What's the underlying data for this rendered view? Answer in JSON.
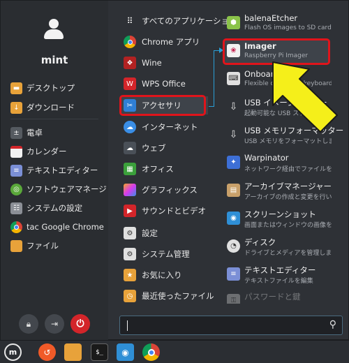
{
  "user": {
    "name": "mint"
  },
  "favorites": [
    {
      "label": "デスクトップ",
      "icon": "desktop-folder-icon",
      "color": "#e8a23a"
    },
    {
      "label": "ダウンロード",
      "icon": "downloads-folder-icon",
      "color": "#e8a23a"
    },
    {
      "label": "電卓",
      "icon": "calculator-icon",
      "color": "#555a60"
    },
    {
      "label": "カレンダー",
      "icon": "calendar-icon",
      "color": "#f2f2f2"
    },
    {
      "label": "テキストエディター",
      "icon": "text-editor-icon",
      "color": "#7b8fd6"
    },
    {
      "label": "ソフトウェアマネージャー",
      "icon": "software-manager-icon",
      "color": "#5aa83a"
    },
    {
      "label": "システムの設定",
      "icon": "system-settings-icon",
      "color": "#8b8f96"
    },
    {
      "label": "tac Google Chrome",
      "icon": "chrome-icon",
      "color": "#4285f4"
    },
    {
      "label": "ファイル",
      "icon": "files-folder-icon",
      "color": "#e8a23a"
    }
  ],
  "categories": [
    {
      "label": "すべてのアプリケーション",
      "icon": "all-apps-icon",
      "color": "#2e3136"
    },
    {
      "label": "Chrome アプリ",
      "icon": "chrome-icon",
      "color": "#4285f4"
    },
    {
      "label": "Wine",
      "icon": "wine-icon",
      "color": "#b22222"
    },
    {
      "label": "WPS Office",
      "icon": "wps-office-icon",
      "color": "#d3252a"
    },
    {
      "label": "アクセサリ",
      "icon": "accessories-icon",
      "color": "#2f7fd6"
    },
    {
      "label": "インターネット",
      "icon": "internet-icon",
      "color": "#3a8ee6"
    },
    {
      "label": "ウェブ",
      "icon": "web-icon",
      "color": "#4a5058"
    },
    {
      "label": "オフィス",
      "icon": "office-icon",
      "color": "#3ba03b"
    },
    {
      "label": "グラフィックス",
      "icon": "graphics-icon",
      "color": "#c04ad6"
    },
    {
      "label": "サウンドとビデオ",
      "icon": "sound-video-icon",
      "color": "#d3252a"
    },
    {
      "label": "設定",
      "icon": "settings-icon",
      "color": "#e0e0e0"
    },
    {
      "label": "システム管理",
      "icon": "system-admin-icon",
      "color": "#e0e0e0"
    },
    {
      "label": "お気に入り",
      "icon": "favorites-icon",
      "color": "#e8a23a"
    },
    {
      "label": "最近使ったファイル",
      "icon": "recent-files-icon",
      "color": "#e8a23a"
    }
  ],
  "apps": [
    {
      "name": "balenaEtcher",
      "desc": "Flash OS images to SD cards",
      "icon": "balena-etcher-icon",
      "color": "#8bc34a"
    },
    {
      "name": "Imager",
      "desc": "Raspberry Pi Imager",
      "icon": "raspberry-pi-icon",
      "color": "#f2f2f2"
    },
    {
      "name": "Onboard",
      "desc": "Flexible on-screen keyboard",
      "icon": "onboard-icon",
      "color": "#e0e0e0"
    },
    {
      "name": "USB イメージライター",
      "desc": "起動可能な USB スティックを作成",
      "icon": "usb-icon",
      "color": "#e0e0e0"
    },
    {
      "name": "USB メモリフォーマッター",
      "desc": "USB メモリをフォーマットします",
      "icon": "usb-formatter-icon",
      "color": "#e0e0e0"
    },
    {
      "name": "Warpinator",
      "desc": "ネットワーク経由でファイルを送受信",
      "icon": "warpinator-icon",
      "color": "#3d6fd6"
    },
    {
      "name": "アーカイブマネージャー",
      "desc": "アーカイブの作成と変更を行います",
      "icon": "archive-manager-icon",
      "color": "#c8a06a"
    },
    {
      "name": "スクリーンショット",
      "desc": "画面またはウィンドウの画像を保存",
      "icon": "screenshot-icon",
      "color": "#2f8fd6"
    },
    {
      "name": "ディスク",
      "desc": "ドライブとメディアを管理します",
      "icon": "disks-icon",
      "color": "#e0e0e0"
    },
    {
      "name": "テキストエディター",
      "desc": "テキストファイルを編集",
      "icon": "text-editor-icon",
      "color": "#7b8fd6"
    },
    {
      "name": "パスワードと鍵",
      "desc": "",
      "icon": "passwords-icon",
      "color": "#e0e0e0"
    }
  ],
  "power": {
    "lock": "lock-icon",
    "logout": "logout-icon",
    "shutdown": "power-icon"
  },
  "search": {
    "value": ""
  },
  "taskbar": [
    {
      "icon": "mint-menu-icon"
    },
    {
      "icon": "timeshift-icon"
    },
    {
      "icon": "files-folder-icon"
    },
    {
      "icon": "terminal-icon",
      "label": "$_"
    },
    {
      "icon": "rss-icon"
    },
    {
      "icon": "chrome-icon"
    }
  ],
  "colors": {
    "highlight": "#e0141b",
    "arrow": "#f5ef1a",
    "connector": "#2a9fd6",
    "accent": "#2f7fd6"
  }
}
